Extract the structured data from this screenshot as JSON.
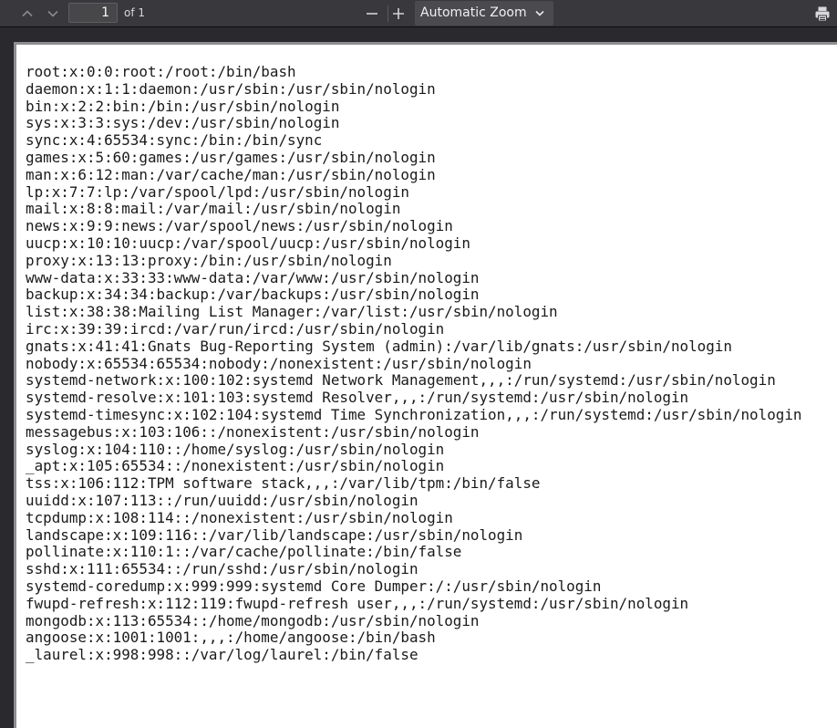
{
  "toolbar": {
    "page_number": "1",
    "page_count": "of 1",
    "zoom": "Automatic Zoom",
    "icons": {
      "prev": "chevron-up-icon",
      "next": "chevron-down-icon",
      "zoom_out": "minus-icon",
      "zoom_in": "plus-icon",
      "dropdown": "chevron-down-icon",
      "print": "printer-icon"
    }
  },
  "document": {
    "lines": [
      "root:x:0:0:root:/root:/bin/bash",
      "daemon:x:1:1:daemon:/usr/sbin:/usr/sbin/nologin",
      "bin:x:2:2:bin:/bin:/usr/sbin/nologin",
      "sys:x:3:3:sys:/dev:/usr/sbin/nologin",
      "sync:x:4:65534:sync:/bin:/bin/sync",
      "games:x:5:60:games:/usr/games:/usr/sbin/nologin",
      "man:x:6:12:man:/var/cache/man:/usr/sbin/nologin",
      "lp:x:7:7:lp:/var/spool/lpd:/usr/sbin/nologin",
      "mail:x:8:8:mail:/var/mail:/usr/sbin/nologin",
      "news:x:9:9:news:/var/spool/news:/usr/sbin/nologin",
      "uucp:x:10:10:uucp:/var/spool/uucp:/usr/sbin/nologin",
      "proxy:x:13:13:proxy:/bin:/usr/sbin/nologin",
      "www-data:x:33:33:www-data:/var/www:/usr/sbin/nologin",
      "backup:x:34:34:backup:/var/backups:/usr/sbin/nologin",
      "list:x:38:38:Mailing List Manager:/var/list:/usr/sbin/nologin",
      "irc:x:39:39:ircd:/var/run/ircd:/usr/sbin/nologin",
      "gnats:x:41:41:Gnats Bug-Reporting System (admin):/var/lib/gnats:/usr/sbin/nologin",
      "nobody:x:65534:65534:nobody:/nonexistent:/usr/sbin/nologin",
      "systemd-network:x:100:102:systemd Network Management,,,:/run/systemd:/usr/sbin/nologin",
      "systemd-resolve:x:101:103:systemd Resolver,,,:/run/systemd:/usr/sbin/nologin",
      "systemd-timesync:x:102:104:systemd Time Synchronization,,,:/run/systemd:/usr/sbin/nologin",
      "messagebus:x:103:106::/nonexistent:/usr/sbin/nologin",
      "syslog:x:104:110::/home/syslog:/usr/sbin/nologin",
      "_apt:x:105:65534::/nonexistent:/usr/sbin/nologin",
      "tss:x:106:112:TPM software stack,,,:/var/lib/tpm:/bin/false",
      "uuidd:x:107:113::/run/uuidd:/usr/sbin/nologin",
      "tcpdump:x:108:114::/nonexistent:/usr/sbin/nologin",
      "landscape:x:109:116::/var/lib/landscape:/usr/sbin/nologin",
      "pollinate:x:110:1::/var/cache/pollinate:/bin/false",
      "sshd:x:111:65534::/run/sshd:/usr/sbin/nologin",
      "systemd-coredump:x:999:999:systemd Core Dumper:/:/usr/sbin/nologin",
      "fwupd-refresh:x:112:119:fwupd-refresh user,,,:/run/systemd:/usr/sbin/nologin",
      "mongodb:x:113:65534::/home/mongodb:/usr/sbin/nologin",
      "angoose:x:1001:1001:,,,:/home/angoose:/bin/bash",
      "_laurel:x:998:998::/var/log/laurel:/bin/false"
    ]
  }
}
